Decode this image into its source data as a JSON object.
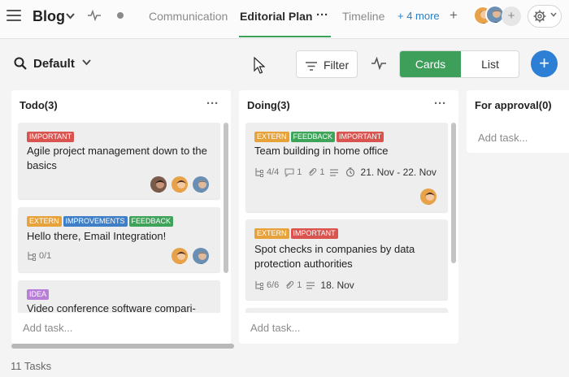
{
  "header": {
    "project_title": "Blog",
    "tabs": [
      {
        "label": "Communication"
      },
      {
        "label": "Editorial Plan"
      },
      {
        "label": "Timeline"
      }
    ],
    "more_tabs_link": "+ 4 more",
    "add_view_label": "+",
    "add_member_label": "+"
  },
  "toolbar": {
    "filter_name": "Default",
    "filter_button_label": "Filter",
    "view_cards_label": "Cards",
    "view_list_label": "List",
    "fab_label": "+"
  },
  "columns": [
    {
      "title": "Todo(3)",
      "add_task_label": "Add task...",
      "cards": [
        {
          "tags": [
            "IMPORTANT"
          ],
          "title": "Agile project management down to the basics"
        },
        {
          "tags": [
            "EXTERN",
            "IMPROVEMENTS",
            "FEEDBACK"
          ],
          "title": "Hello there, Email Integration!",
          "subtasks": "0/1"
        },
        {
          "tags": [
            "IDEA"
          ],
          "title": "Video conference software compari-"
        }
      ]
    },
    {
      "title": "Doing(3)",
      "add_task_label": "Add task...",
      "cards": [
        {
          "tags": [
            "EXTERN",
            "FEEDBACK",
            "IMPORTANT"
          ],
          "title": "Team building in home office",
          "subtasks": "4/4",
          "comments": "1",
          "attachments": "1",
          "date": "21. Nov - 22. Nov"
        },
        {
          "tags": [
            "EXTERN",
            "IMPORTANT"
          ],
          "title": "Spot checks in companies by data protection authorities",
          "subtasks": "6/6",
          "attachments": "1",
          "date": "18. Nov"
        }
      ]
    },
    {
      "title": "For approval(0)",
      "add_task_label": "Add task..."
    }
  ],
  "footer": {
    "task_count": "11 Tasks"
  },
  "colors": {
    "accent_green": "#3e9f5b",
    "accent_blue": "#2d7fd6",
    "tag_important": "#d9534f",
    "tag_extern": "#e8a23a",
    "tag_improvements": "#3e7fc8",
    "tag_feedback": "#3ea45a",
    "tag_idea": "#b97fd8"
  }
}
